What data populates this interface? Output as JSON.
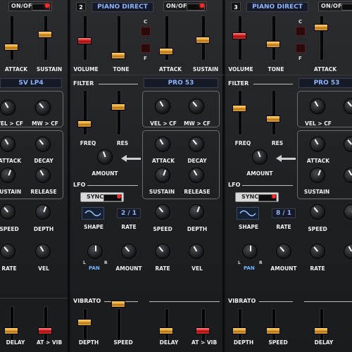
{
  "labels": {
    "onoff": "ON/OFF",
    "patch": "PIANO DIRECT",
    "attack": "ATTACK",
    "sustain": "SUSTAIN",
    "volume": "VOLUME",
    "tone": "TONE",
    "filter": "FILTER",
    "freq": "FREQ",
    "res": "RES",
    "amount": "AMOUNT",
    "vel_cf": "VEL > CF",
    "mw_cf": "MW > CF",
    "decay": "DECAY",
    "release": "RELEASE",
    "lfo": "LFO",
    "sync": "SYNC",
    "shape": "SHAPE",
    "rate": "RATE",
    "speed": "SPEED",
    "depth": "DEPTH",
    "vel": "VEL",
    "pan": "PAN",
    "vibrato": "VIBRATO",
    "delay": "DELAY",
    "at_vib": "AT > VIB",
    "c": "C",
    "f": "F",
    "l": "L",
    "r": "R"
  },
  "scale_ticks": [
    "8",
    "6",
    "4",
    "2",
    "0",
    "2",
    "4",
    "6",
    "8"
  ],
  "partials": [
    {
      "number": "2",
      "filter_type": "PRO 53",
      "lfo_rate": "2 / 1"
    },
    {
      "number": "3",
      "filter_type": "PRO 53",
      "lfo_rate": "8 / 1"
    }
  ],
  "left_partial": {
    "filter_type": "SV LP4"
  },
  "icons": {
    "lfo_shape": "sine-wave-icon",
    "arrow": "left-arrow-icon",
    "led": "led-icon"
  },
  "colors": {
    "led_on": "#ff2a2a",
    "lcd_text": "#8fb4ff",
    "fader_orange": "#e3a02c",
    "fader_red": "#d82020"
  }
}
